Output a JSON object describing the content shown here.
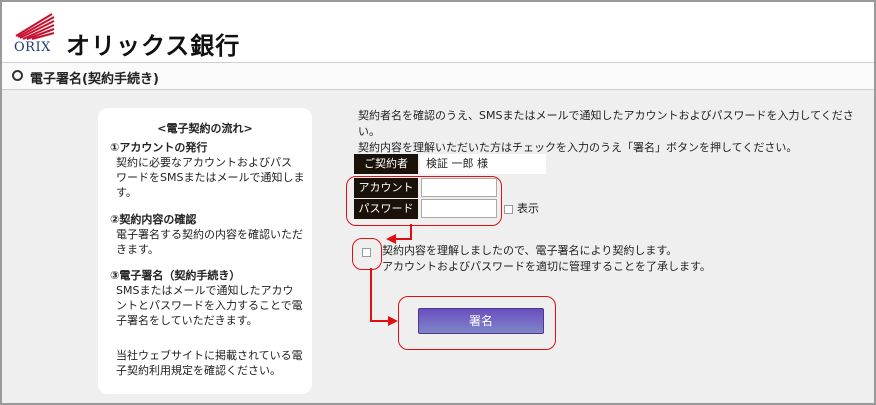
{
  "header": {
    "logo_text": "ORIX",
    "bank_name": "オリックス銀行"
  },
  "page_title": "電子署名(契約手続き)",
  "flow": {
    "title": "<電子契約の流れ>",
    "steps": [
      {
        "heading": "①アカウントの発行",
        "lines": [
          "契約に必要なアカウントおよびパス",
          "ワードをSMSまたはメールで通知しま",
          "す。"
        ]
      },
      {
        "heading": "②契約内容の確認",
        "lines": [
          "電子署名する契約の内容を確認いただ",
          "きます。"
        ]
      },
      {
        "heading": "③電子署名（契約手続き）",
        "lines": [
          "SMSまたはメールで通知したアカウ",
          "ントとパスワードを入力することで電",
          "子署名をしていただきます。"
        ]
      }
    ],
    "note_lines": [
      "当社ウェブサイトに掲載されている電",
      "子契約利用規定を確認ください。"
    ]
  },
  "instructions": [
    "契約者名を確認のうえ、SMSまたはメールで通知したアカウントおよびパスワードを入力してください。",
    "契約内容を理解いただいた方はチェックを入力のうえ「署名」ボタンを押してください。"
  ],
  "form": {
    "contractor_label": "ご契約者",
    "contractor_name": "検証 一郎 様",
    "account_label": "アカウント",
    "account_value": "",
    "password_label": "パスワード",
    "password_value": "",
    "show_label": "表示",
    "agree_lines": [
      "契約内容を理解しましたので、電子署名により契約します。",
      "アカウントおよびパスワードを適切に管理することを了承します。"
    ],
    "sign_button": "署名"
  },
  "colors": {
    "label_bg": "#1a1208",
    "highlight": "#e01010",
    "button": "#6a4fbf",
    "logo": "#1f3a7a"
  }
}
